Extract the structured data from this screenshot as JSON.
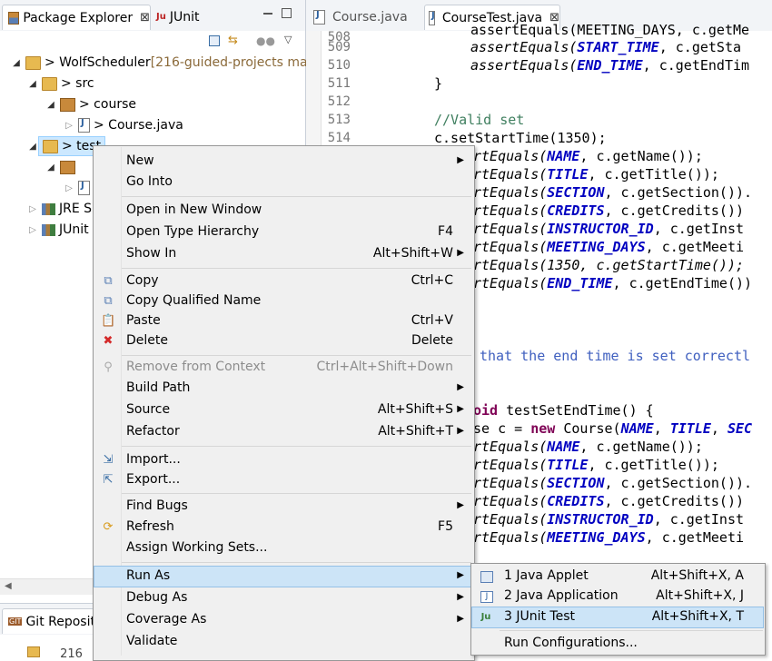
{
  "left_view": {
    "tabs": [
      {
        "label": "Package Explorer",
        "icon": "package-explorer-icon",
        "active": true,
        "close": "⊠"
      },
      {
        "label": "JUnit",
        "icon": "junit-icon",
        "active": false
      }
    ],
    "tree": [
      {
        "label": "> WolfScheduler",
        "suffix": " [216-guided-projects mas",
        "expanded": true
      },
      {
        "label": "> src",
        "expanded": true
      },
      {
        "label": "> course",
        "expanded": true
      },
      {
        "label": "> Course.java",
        "expanded": false
      },
      {
        "label": "> test",
        "expanded": true,
        "selected": true
      },
      {
        "label": "JRE S",
        "expanded": false
      },
      {
        "label": "JUnit",
        "expanded": false
      }
    ],
    "bottom_tab": {
      "label": "Git Reposit",
      "icon": "git-icon"
    },
    "bottom_text": "216"
  },
  "editor": {
    "tabs": [
      {
        "label": "Course.java",
        "active": false
      },
      {
        "label": "CourseTest.java",
        "active": true,
        "close": "⊠"
      }
    ],
    "line_numbers": [
      "508",
      "509",
      "510",
      "511",
      "512",
      "513",
      "514"
    ],
    "code": {
      "l508": "assertEquals(MEETING_DAYS, c.getMe",
      "l509a": "assertEquals(",
      "l509b": "START_TIME",
      "l509c": ", c.getSta",
      "l510a": "assertEquals(",
      "l510b": "END_TIME",
      "l510c": ", c.getEndTim",
      "l511": "}",
      "l513": "//Valid set",
      "l514": "c.setStartTime(1350);",
      "r1a": "rtEquals(",
      "r1b": "NAME",
      "r1c": ", c.getName());",
      "r2a": "rtEquals(",
      "r2b": "TITLE",
      "r2c": ", c.getTitle());",
      "r3a": "rtEquals(",
      "r3b": "SECTION",
      "r3c": ", c.getSection()).",
      "r4a": "rtEquals(",
      "r4b": "CREDITS",
      "r4c": ", c.getCredits())",
      "r5a": "rtEquals(",
      "r5b": "INSTRUCTOR_ID",
      "r5c": ", c.getInst",
      "r6a": "rtEquals(",
      "r6b": "MEETING_DAYS",
      "r6c": ", c.getMeeti",
      "r7": "rtEquals(1350, c.getStartTime());",
      "r8a": "rtEquals(",
      "r8b": "END_TIME",
      "r8c": ", c.getEndTime())",
      "r9": "that the end time is set correctl",
      "r10a": "oid",
      "r10b": " testSetEndTime() {",
      "r11a": "se c = ",
      "r11b": "new",
      "r11c": " Course(",
      "r11d": "NAME",
      "r11e": ", ",
      "r11f": "TITLE",
      "r11g": ", ",
      "r11h": "SEC",
      "r12a": "rtEquals(",
      "r12b": "NAME",
      "r12c": ", c.getName());",
      "r13a": "rtEquals(",
      "r13b": "TITLE",
      "r13c": ", c.getTitle());",
      "r14a": "rtEquals(",
      "r14b": "SECTION",
      "r14c": ", c.getSection()).",
      "r15a": "rtEquals(",
      "r15b": "CREDITS",
      "r15c": ", c.getCredits())",
      "r16a": "rtEquals(",
      "r16b": "INSTRUCTOR_ID",
      "r16c": ", c.getInst",
      "r17a": "rtEquals(",
      "r17b": "MEETING_DAYS",
      "r17c": ", c.getMeeti"
    }
  },
  "context_menu": {
    "items": [
      {
        "label": "New",
        "submenu": true
      },
      {
        "label": "Go Into"
      },
      {
        "label": "Open in New Window"
      },
      {
        "label": "Open Type Hierarchy",
        "shortcut": "F4"
      },
      {
        "label": "Show In",
        "shortcut": "Alt+Shift+W",
        "submenu": true
      },
      {
        "label": "Copy",
        "shortcut": "Ctrl+C",
        "icon": "copy-icon"
      },
      {
        "label": "Copy Qualified Name",
        "icon": "copy-qualified-icon"
      },
      {
        "label": "Paste",
        "shortcut": "Ctrl+V",
        "icon": "paste-icon"
      },
      {
        "label": "Delete",
        "shortcut": "Delete",
        "icon": "delete-icon"
      },
      {
        "label": "Remove from Context",
        "shortcut": "Ctrl+Alt+Shift+Down",
        "disabled": true,
        "icon": "remove-context-icon"
      },
      {
        "label": "Build Path",
        "submenu": true
      },
      {
        "label": "Source",
        "shortcut": "Alt+Shift+S",
        "submenu": true
      },
      {
        "label": "Refactor",
        "shortcut": "Alt+Shift+T",
        "submenu": true
      },
      {
        "label": "Import...",
        "icon": "import-icon"
      },
      {
        "label": "Export...",
        "icon": "export-icon"
      },
      {
        "label": "Find Bugs",
        "submenu": true
      },
      {
        "label": "Refresh",
        "shortcut": "F5",
        "icon": "refresh-icon"
      },
      {
        "label": "Assign Working Sets..."
      },
      {
        "label": "Run As",
        "submenu": true,
        "hover": true
      },
      {
        "label": "Debug As",
        "submenu": true
      },
      {
        "label": "Coverage As",
        "submenu": true
      },
      {
        "label": "Validate"
      }
    ]
  },
  "run_as_submenu": {
    "items": [
      {
        "label": "1 Java Applet",
        "shortcut": "Alt+Shift+X, A",
        "icon": "java-applet-icon"
      },
      {
        "label": "2 Java Application",
        "shortcut": "Alt+Shift+X, J",
        "icon": "java-application-icon"
      },
      {
        "label": "3 JUnit Test",
        "shortcut": "Alt+Shift+X, T",
        "icon": "junit-test-icon",
        "hover": true
      },
      {
        "label": "Run Configurations..."
      }
    ]
  },
  "colors": {
    "keyword": "#7f0055",
    "constant": "#0000c0",
    "comment": "#3f7f5f",
    "menu_hover": "#cce4f7",
    "selection": "#cce8ff"
  }
}
